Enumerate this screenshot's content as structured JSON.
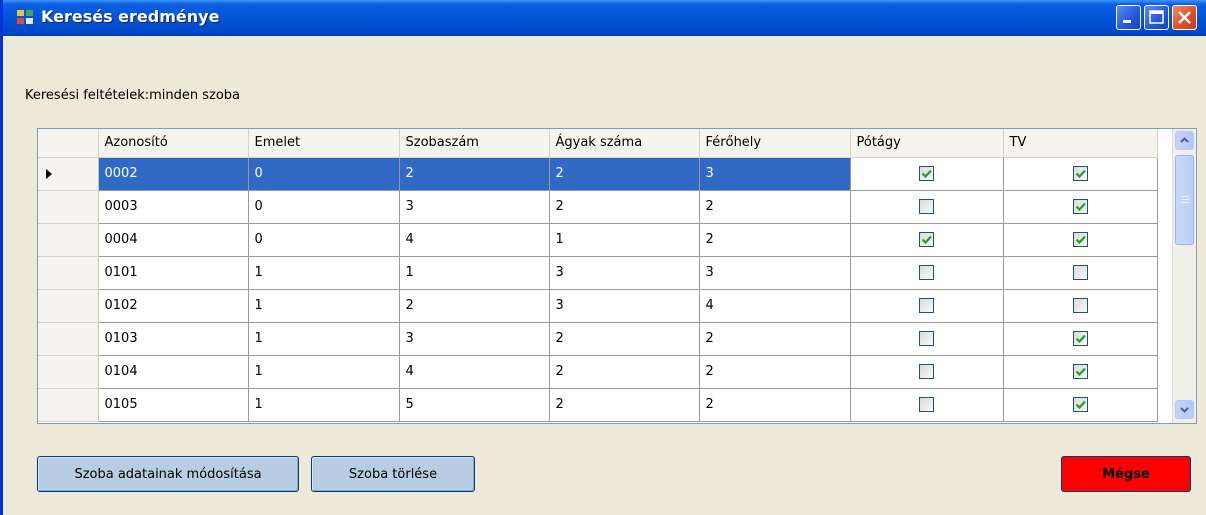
{
  "window": {
    "title": "Keresés eredménye"
  },
  "criteria_text": "Keresési feltételek:minden szoba",
  "grid": {
    "columns": [
      "Azonosító",
      "Emelet",
      "Szobaszám",
      "Ágyak száma",
      "Férőhely",
      "Pótágy",
      "TV"
    ],
    "rows": [
      {
        "id": "0002",
        "emelet": "0",
        "szobaszam": "2",
        "agyak": "2",
        "ferohely": "3",
        "potagy": true,
        "tv": true
      },
      {
        "id": "0003",
        "emelet": "0",
        "szobaszam": "3",
        "agyak": "2",
        "ferohely": "2",
        "potagy": false,
        "tv": true
      },
      {
        "id": "0004",
        "emelet": "0",
        "szobaszam": "4",
        "agyak": "1",
        "ferohely": "2",
        "potagy": true,
        "tv": true
      },
      {
        "id": "0101",
        "emelet": "1",
        "szobaszam": "1",
        "agyak": "3",
        "ferohely": "3",
        "potagy": false,
        "tv": false
      },
      {
        "id": "0102",
        "emelet": "1",
        "szobaszam": "2",
        "agyak": "3",
        "ferohely": "4",
        "potagy": false,
        "tv": false
      },
      {
        "id": "0103",
        "emelet": "1",
        "szobaszam": "3",
        "agyak": "2",
        "ferohely": "2",
        "potagy": false,
        "tv": true
      },
      {
        "id": "0104",
        "emelet": "1",
        "szobaszam": "4",
        "agyak": "2",
        "ferohely": "2",
        "potagy": false,
        "tv": true
      },
      {
        "id": "0105",
        "emelet": "1",
        "szobaszam": "5",
        "agyak": "2",
        "ferohely": "2",
        "potagy": false,
        "tv": true
      }
    ],
    "selected_row": 0
  },
  "buttons": {
    "modify": "Szoba adatainak módosítása",
    "delete": "Szoba törlése",
    "cancel": "Mégse"
  },
  "colors": {
    "selection": "#316AC5",
    "cancel_button": "#FF0000",
    "titlebar": "#0553D6"
  }
}
